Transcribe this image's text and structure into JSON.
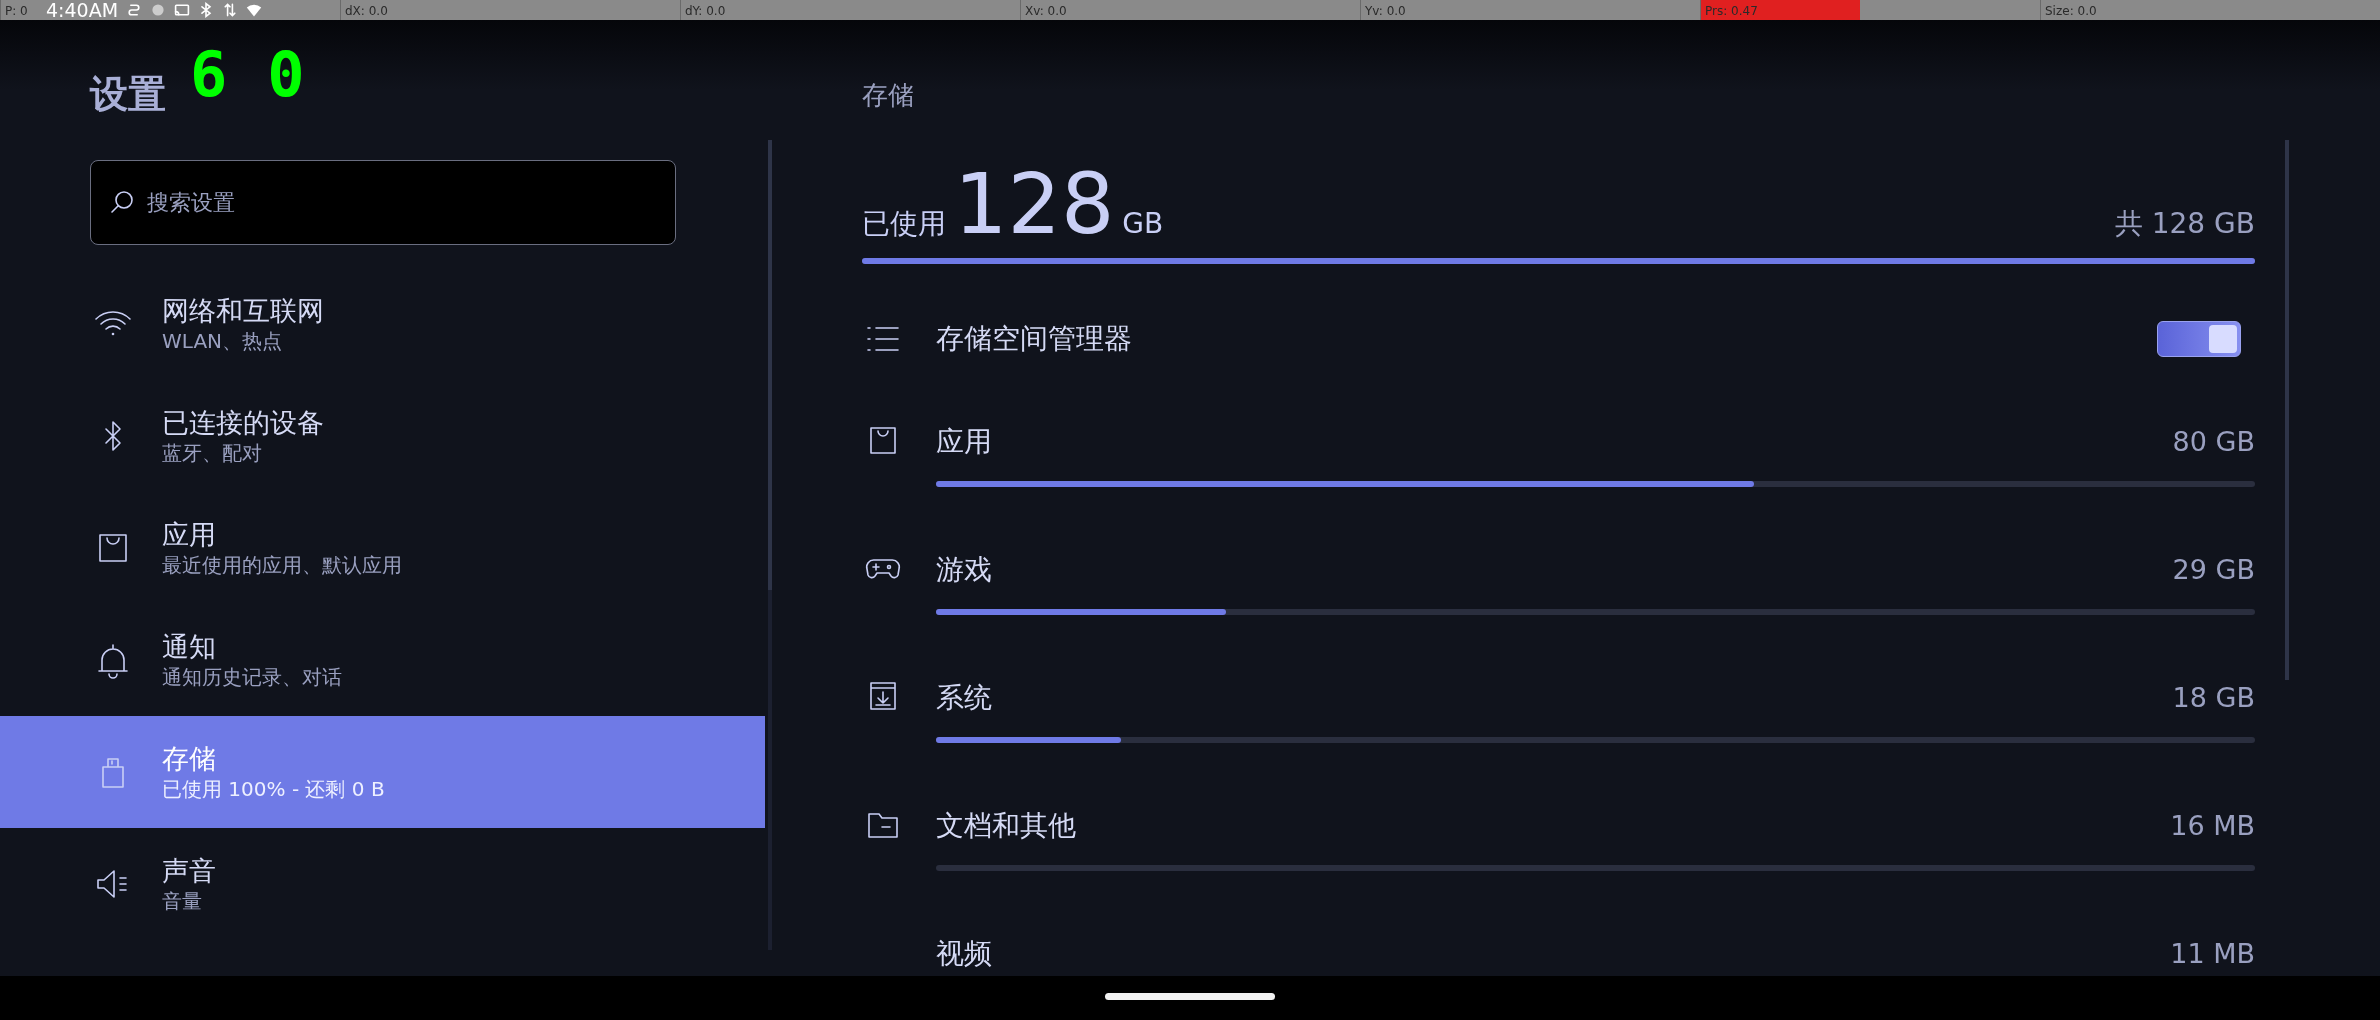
{
  "status_bar": {
    "time": "4:40AM"
  },
  "pointer_overlay": [
    {
      "text": "P: 0"
    },
    {
      "text": "dX: 0.0"
    },
    {
      "text": "dY: 0.0"
    },
    {
      "text": "Xv: 0.0"
    },
    {
      "text": "Yv: 0.0"
    },
    {
      "text": "Prs: 0.47",
      "level": 0.47
    },
    {
      "text": "Size: 0.0"
    }
  ],
  "fps_counter": "60",
  "sidebar": {
    "title": "设置",
    "search": {
      "placeholder": "搜索设置"
    },
    "items": [
      {
        "title": "网络和互联网",
        "subtitle": "WLAN、热点",
        "selected": false
      },
      {
        "title": "已连接的设备",
        "subtitle": "蓝牙、配对",
        "selected": false
      },
      {
        "title": "应用",
        "subtitle": "最近使用的应用、默认应用",
        "selected": false
      },
      {
        "title": "通知",
        "subtitle": "通知历史记录、对话",
        "selected": false
      },
      {
        "title": "存储",
        "subtitle": "已使用 100% - 还剩 0 B",
        "selected": true
      },
      {
        "title": "声音",
        "subtitle": "音量",
        "selected": false
      }
    ]
  },
  "storage": {
    "header": "存储",
    "used_label": "已使用",
    "used_value": "128",
    "used_unit": "GB",
    "total": "共 128 GB",
    "level": 1.0,
    "manager": {
      "label": "存储空间管理器",
      "on": true
    },
    "categories": [
      {
        "name": "应用",
        "size": "80 GB",
        "level": 0.62
      },
      {
        "name": "游戏",
        "size": "29 GB",
        "level": 0.22
      },
      {
        "name": "系统",
        "size": "18 GB",
        "level": 0.14
      },
      {
        "name": "文档和其他",
        "size": "16 MB"
      },
      {
        "name": "视频",
        "size": "11 MB"
      }
    ]
  }
}
